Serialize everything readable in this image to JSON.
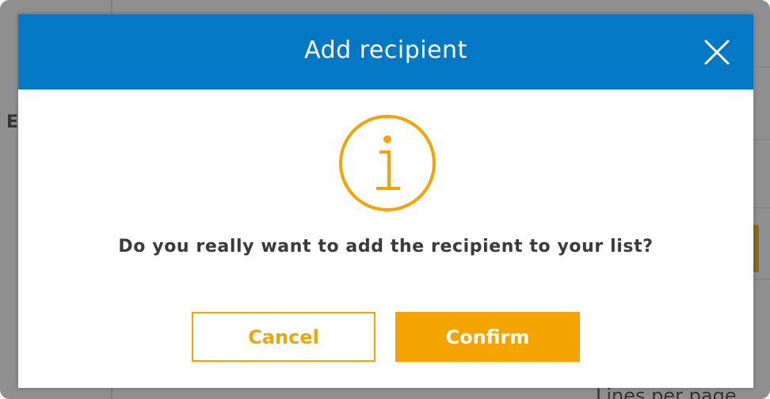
{
  "background": {
    "partial_letter": "E",
    "footer_text": "Lines per page"
  },
  "dialog": {
    "title": "Add recipient",
    "close_icon": "close-icon",
    "status_icon": "info-icon",
    "message": "Do you really want to add the recipient to your list?",
    "buttons": {
      "cancel_label": "Cancel",
      "confirm_label": "Confirm"
    }
  },
  "colors": {
    "header": "#0478c4",
    "accent": "#f4a400",
    "text": "#3a3a3a",
    "overlay": "#8f8f8f"
  }
}
